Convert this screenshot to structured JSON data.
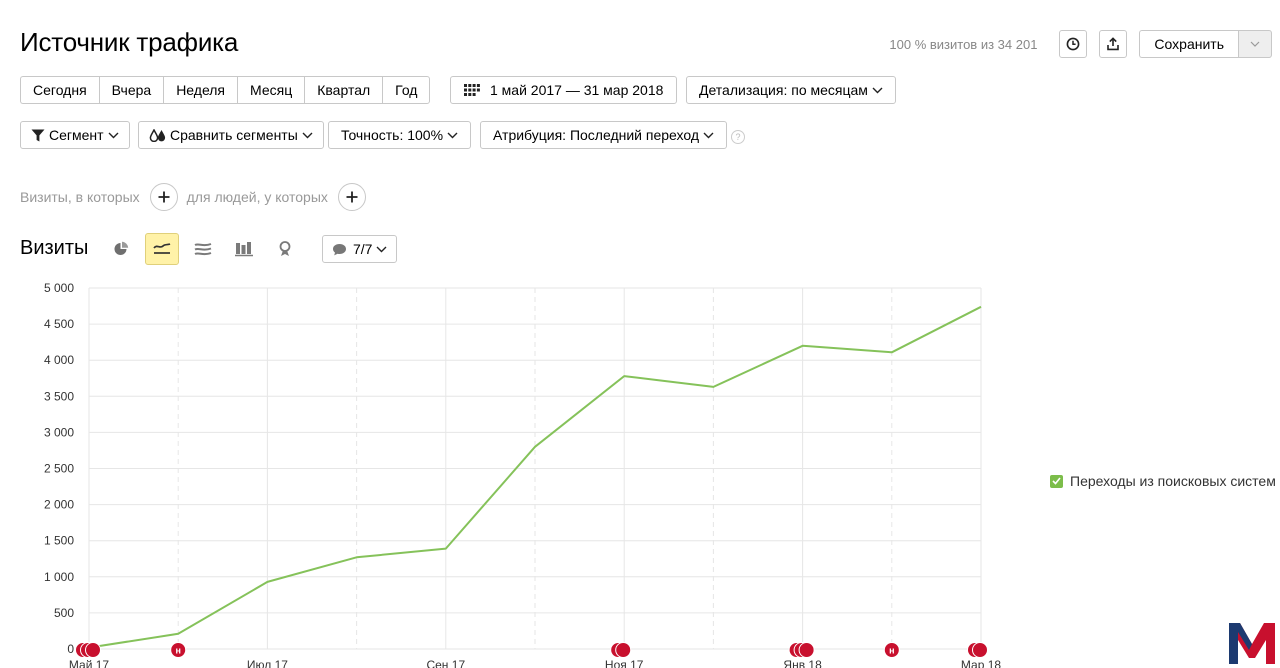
{
  "header": {
    "title": "Источник трафика",
    "visits_info": "100 % визитов из 34 201",
    "save_label": "Сохранить"
  },
  "period": {
    "segments": [
      "Сегодня",
      "Вчера",
      "Неделя",
      "Месяц",
      "Квартал",
      "Год"
    ],
    "date_range": "1 май 2017 — 31 мар 2018",
    "detail": "Детализация: по месяцам"
  },
  "filters": {
    "segment": "Сегмент",
    "compare": "Сравнить сегменты",
    "accuracy": "Точность: 100%",
    "attribution": "Атрибуция: Последний переход",
    "help": "?"
  },
  "conditions": {
    "visits_label": "Визиты, в которых",
    "people_label": "для людей, у которых"
  },
  "chart_section": {
    "title": "Визиты",
    "notes_label": "7/7"
  },
  "colors": {
    "series_line": "#85c25a",
    "grid": "#e6e6e6",
    "marker": "#c8102e",
    "active_chart_type": "#fff2a8",
    "logo": "#c8102e"
  },
  "chart_data": {
    "type": "line",
    "x": [
      "Май 17",
      "Июн 17",
      "Июл 17",
      "Авг 17",
      "Сен 17",
      "Окт 17",
      "Ноя 17",
      "Дек 17",
      "Янв 18",
      "Фев 18",
      "Мар 18"
    ],
    "x_tick_labels": [
      "Май 17",
      "Июл 17",
      "Сен 17",
      "Ноя 17",
      "Янв 18",
      "Мар 18"
    ],
    "series": [
      {
        "name": "Переходы из поисковых систем",
        "values": [
          20,
          210,
          930,
          1270,
          1390,
          2800,
          3780,
          3630,
          4200,
          4110,
          4740
        ]
      }
    ],
    "ylim": [
      0,
      5000
    ],
    "y_ticks": [
      0,
      500,
      1000,
      1500,
      2000,
      2500,
      3000,
      3500,
      4000,
      4500,
      5000
    ],
    "y_tick_labels": [
      "0",
      "500",
      "1 000",
      "1 500",
      "2 000",
      "2 500",
      "3 000",
      "3 500",
      "4 000",
      "4 500",
      "5 000"
    ],
    "grid": true,
    "legend_position": "right",
    "note_markers": [
      {
        "x": "Май 17",
        "count": 3,
        "label": "н"
      },
      {
        "x": "Июн 17",
        "count": 1,
        "label": "н"
      },
      {
        "x": "Ноя 17",
        "count": 2,
        "label": "н"
      },
      {
        "x": "Янв 18",
        "count": 3,
        "label": "н"
      },
      {
        "x": "Фев 18",
        "count": 1,
        "label": "н"
      },
      {
        "x": "Мар 18",
        "count": 2,
        "label": "н"
      }
    ]
  }
}
